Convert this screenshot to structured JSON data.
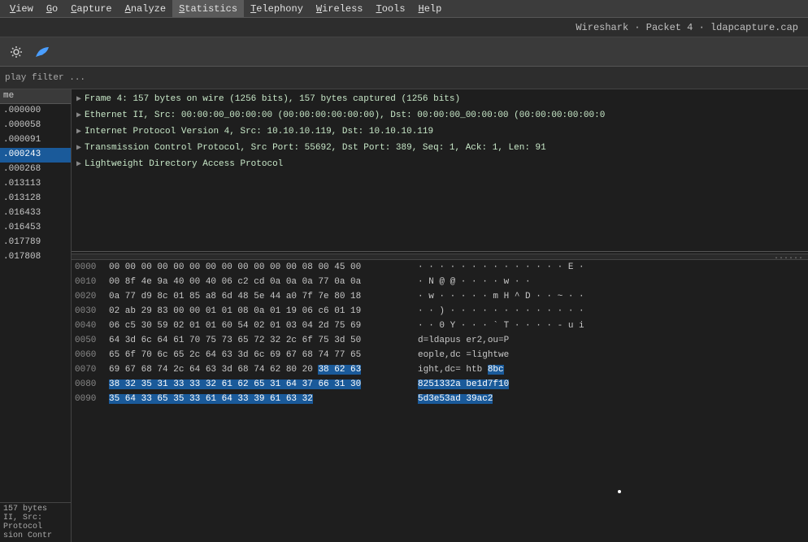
{
  "menubar": {
    "items": [
      {
        "label": "View",
        "underline": "V"
      },
      {
        "label": "Go",
        "underline": "G"
      },
      {
        "label": "Capture",
        "underline": "C"
      },
      {
        "label": "Analyze",
        "underline": "A"
      },
      {
        "label": "Statistics",
        "underline": "S"
      },
      {
        "label": "Telephony",
        "underline": "T"
      },
      {
        "label": "Wireless",
        "underline": "W"
      },
      {
        "label": "Tools",
        "underline": "T"
      },
      {
        "label": "Help",
        "underline": "H"
      }
    ]
  },
  "titlebar": {
    "text": "Wireshark · Packet 4 · ldapcapture.cap"
  },
  "filterbar": {
    "label": "play filter ..."
  },
  "packet_list": {
    "header": "me",
    "rows": [
      {
        "time": ".000000",
        "selected": false
      },
      {
        "time": ".000058",
        "selected": false
      },
      {
        "time": ".000091",
        "selected": false
      },
      {
        "time": ".000243",
        "selected": true
      },
      {
        "time": ".000268",
        "selected": false
      },
      {
        "time": ".013113",
        "selected": false
      },
      {
        "time": ".013128",
        "selected": false
      },
      {
        "time": ".016433",
        "selected": false
      },
      {
        "time": ".016453",
        "selected": false
      },
      {
        "time": ".017789",
        "selected": false
      },
      {
        "time": ".017808",
        "selected": false
      }
    ]
  },
  "packet_detail": {
    "rows": [
      {
        "arrow": "▶",
        "text": "Frame 4: 157 bytes on wire (1256 bits), 157 bytes captured (1256 bits)"
      },
      {
        "arrow": "▶",
        "text": "Ethernet II, Src: 00:00:00_00:00:00 (00:00:00:00:00:00), Dst: 00:00:00_00:00:00 (00:00:00:00:00:0"
      },
      {
        "arrow": "▶",
        "text": "Internet Protocol Version 4, Src: 10.10.10.119, Dst: 10.10.10.119"
      },
      {
        "arrow": "▶",
        "text": "Transmission Control Protocol, Src Port: 55692, Dst Port: 389, Seq: 1, Ack: 1, Len: 91"
      },
      {
        "arrow": "▶",
        "text": "Lightweight Directory Access Protocol"
      }
    ]
  },
  "hex_dump": {
    "separator_dots": "......",
    "rows": [
      {
        "offset": "0000",
        "hex": "00 00 00 00 00 00 00 00   00 00 00 00 08 00 45 00",
        "ascii": "· · · · · · · ·   · · · · · · E ·"
      },
      {
        "offset": "0010",
        "hex": "00 8f 4e 9a 40 00 40 06   c2 cd 0a 0a 0a 77 0a 0a",
        "ascii": "· N @ @   · · · · · · w · ·"
      },
      {
        "offset": "0020",
        "hex": "0a 77 d9 8c 01 85 a8 6d   48 5e 44 a0 7f 7e 80 18",
        "ascii": "· w · · · · · m   H ^ D · · ~ · ·"
      },
      {
        "offset": "0030",
        "hex": "02 ab 29 83 00 00 01 01   08 0a 01 19 06 c6 01 19",
        "ascii": "· · ) · · · · ·   · · · · · · · ·"
      },
      {
        "offset": "0040",
        "hex": "06 c5 30 59 02 01 01 60   54 02 01 03 04 2d 75 69",
        "ascii": "· · 0 Y · · · `   T · · · · - u i"
      },
      {
        "offset": "0050",
        "hex": "64 3d 6c 64 61 70 75 73   65 72 32 2c 6f 75 3d 50",
        "ascii": "d = l d a p u s   e r 2 , o u = P"
      },
      {
        "offset": "0060",
        "hex": "65 6f 70 6c 65 2c 64 63   3d 6c 69 67 68 74 77 65",
        "ascii": "e o p l e , d c   = l i g h t w e"
      },
      {
        "offset": "0070",
        "hex": "69 67 68 74 2c 64 63 3d   68 74 62 80 20",
        "hex_highlighted": "38 62 63",
        "ascii_pre": "i g h t , d c =   h t b  ",
        "ascii_highlighted": "8bc",
        "highlight": true
      },
      {
        "offset": "0080",
        "hex_highlighted_full": "38 32 35 31 33 33 32 61   62 65 31 64 37 66 31 30",
        "ascii_highlighted_full": "8251332a be1d7f10",
        "highlight": true
      },
      {
        "offset": "0090",
        "hex_highlighted_full": "35 64 33 65 35 33 61 64   33 39 61 63 32",
        "ascii_highlighted_full": "5d3e53ad 39ac2",
        "highlight": true
      }
    ]
  },
  "statusbar": {
    "lines": [
      "157 bytes",
      "II, Src:",
      "Protocol",
      "sion Contr"
    ]
  }
}
